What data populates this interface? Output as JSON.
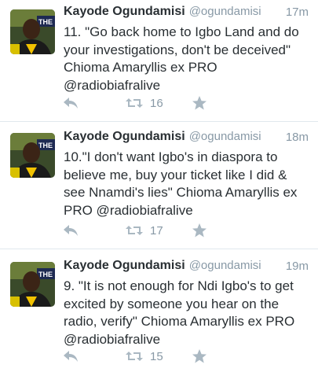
{
  "tweets": [
    {
      "name": "Kayode Ogundamisi",
      "handle": "@ogundamisi",
      "time": "17m",
      "text": "11. \"Go back home to Igbo Land and do your investigations, don't be deceived\" Chioma Amaryllis ex PRO @radiobiafralive",
      "retweets": "16"
    },
    {
      "name": "Kayode Ogundamisi",
      "handle": "@ogundamisi",
      "time": "18m",
      "text": "10.\"I don't want Igbo's in diaspora to believe me, buy your ticket like I did & see Nnamdi's lies\" Chioma Amaryllis ex PRO @radiobiafralive",
      "retweets": "17"
    },
    {
      "name": "Kayode Ogundamisi",
      "handle": "@ogundamisi",
      "time": "19m",
      "text": "9. \"It is not enough for Ndi Igbo's to get excited by someone you hear on the radio, verify\"  Chioma Amaryllis ex PRO @radiobiafralive",
      "retweets": "15"
    }
  ],
  "icons": {
    "reply": "reply-arrow-icon",
    "retweet": "retweet-icon",
    "favorite": "star-icon"
  },
  "colors": {
    "name": "#292f33",
    "meta": "#8899a6",
    "action_icon": "#aab8c2",
    "divider": "#e1e8ed"
  }
}
